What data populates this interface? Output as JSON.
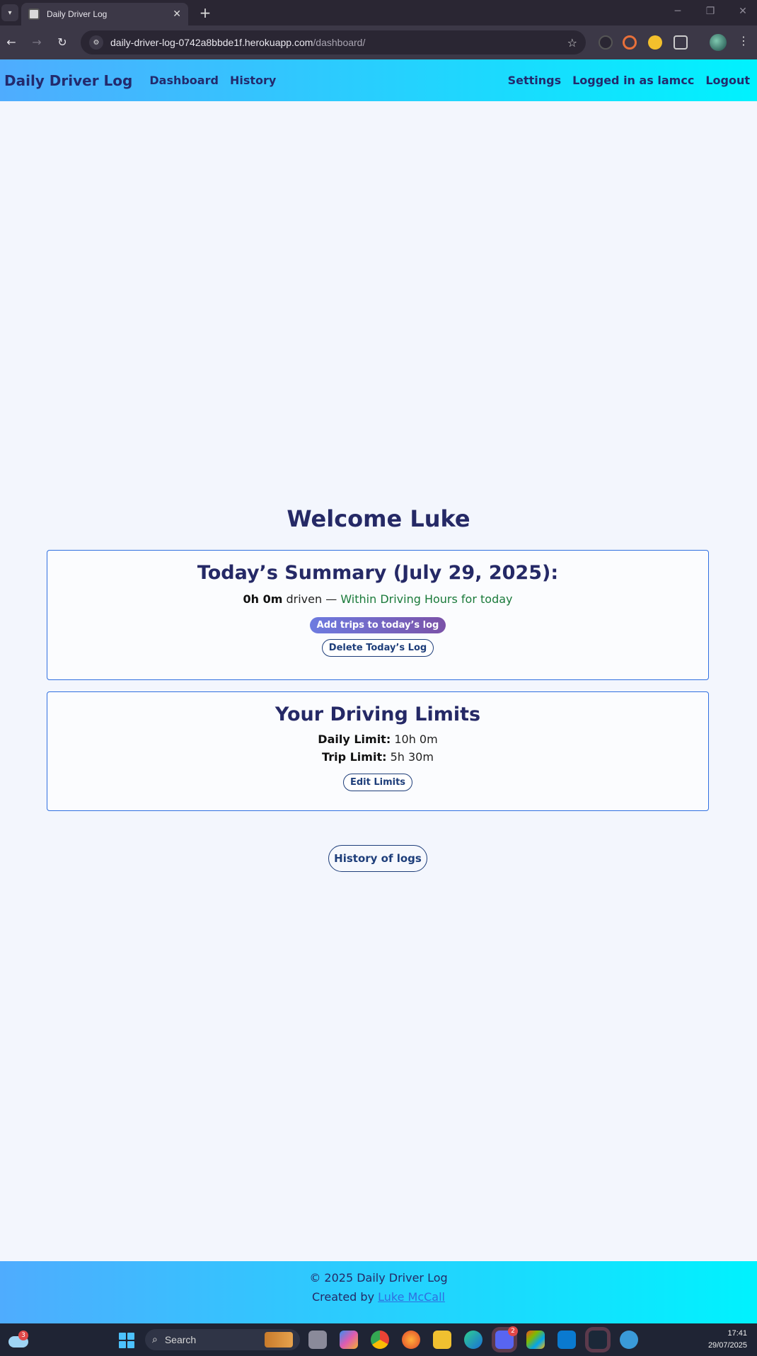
{
  "browser": {
    "tab_title": "Daily Driver Log",
    "url_host": "daily-driver-log-0742a8bbde1f.herokuapp.com",
    "url_path": "/dashboard/"
  },
  "navbar": {
    "brand": "Daily Driver Log",
    "links": [
      "Dashboard",
      "History"
    ],
    "settings": "Settings",
    "user_status": "Logged in as lamcc",
    "logout": "Logout"
  },
  "main": {
    "welcome": "Welcome Luke",
    "summary": {
      "title": "Today’s Summary (July 29, 2025):",
      "driven_time": "0h 0m",
      "driven_word": "driven — ",
      "status": "Within Driving Hours for today",
      "add_button": "Add trips to today’s log",
      "delete_button": "Delete Today’s Log"
    },
    "limits": {
      "title": "Your Driving Limits",
      "daily_label": "Daily Limit:",
      "daily_value": "10h 0m",
      "trip_label": "Trip Limit:",
      "trip_value": "5h 30m",
      "edit_button": "Edit Limits"
    },
    "history_button": "History of logs"
  },
  "footer": {
    "copyright": "© 2025 Daily Driver Log",
    "created_by": "Created by",
    "author": "Luke McCall"
  },
  "taskbar": {
    "weather_badge": "3",
    "search_placeholder": "Search",
    "discord_badge": "2",
    "time": "17:41",
    "date": "29/07/2025"
  },
  "colors": {
    "navbar_gradient": [
      "#4facfe",
      "#00f2fe"
    ],
    "heading": "#252966",
    "card_border": "#2f6fe0",
    "status_ok": "#1a7a3a"
  }
}
